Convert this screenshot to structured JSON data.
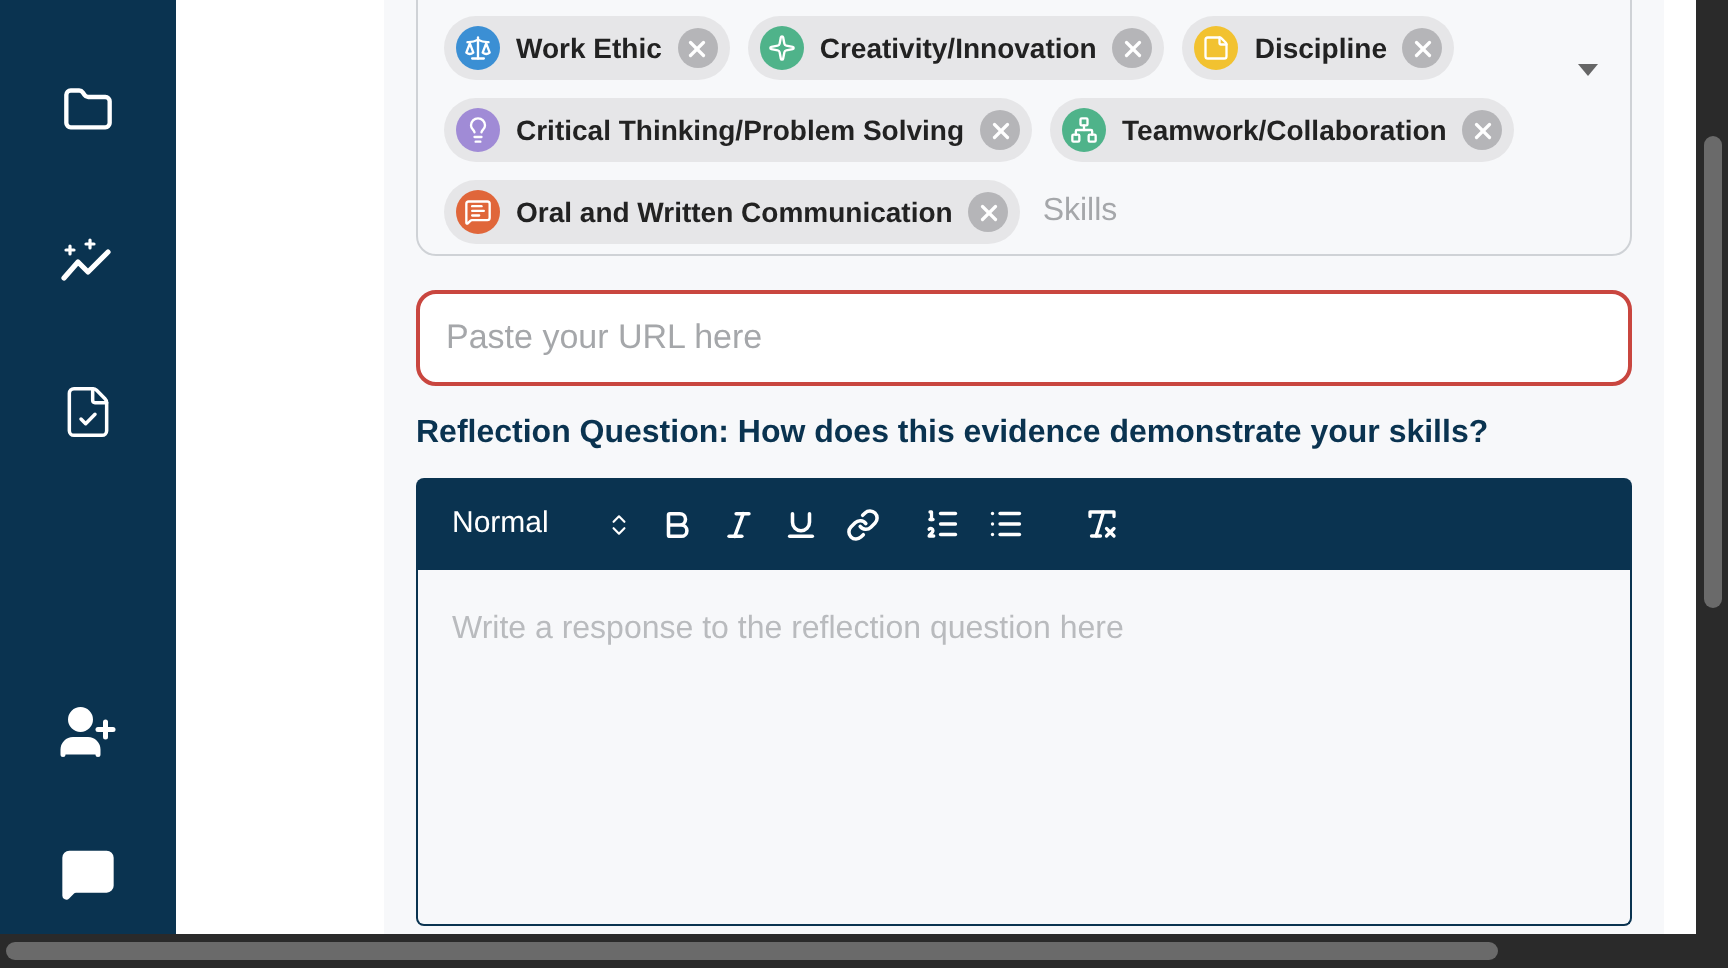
{
  "skills": {
    "chips": [
      {
        "label": "Work Ethic",
        "kind": "scale",
        "color": "#3b8fd4"
      },
      {
        "label": "Creativity/Innovation",
        "kind": "spark",
        "color": "#4fb38a"
      },
      {
        "label": "Discipline",
        "kind": "note",
        "color": "#f2c230"
      },
      {
        "label": "Critical Thinking/Problem Solving",
        "kind": "bulb",
        "color": "#a08bd6"
      },
      {
        "label": "Teamwork/Collaboration",
        "kind": "team",
        "color": "#4fb38a"
      },
      {
        "label": "Oral and Written Communication",
        "kind": "speech",
        "color": "#e0663a"
      }
    ],
    "placeholder": "Skills"
  },
  "url_field": {
    "placeholder": "Paste your URL here",
    "focused": true
  },
  "reflection": {
    "question": "Reflection Question: How does this evidence demonstrate your skills?",
    "format": "Normal",
    "placeholder": "Write a response to the reflection question here"
  }
}
